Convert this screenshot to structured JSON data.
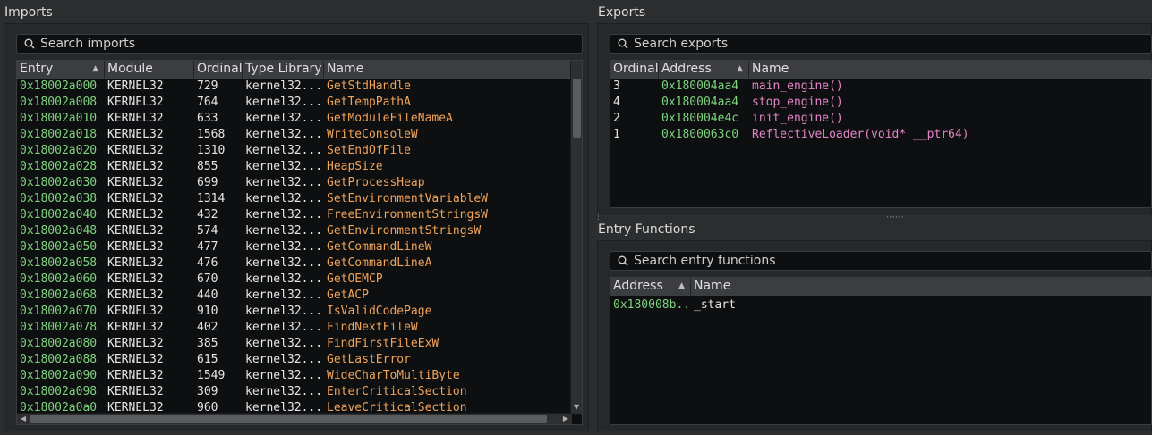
{
  "imports": {
    "title": "Imports",
    "search_placeholder": "Search imports",
    "columns": [
      "Entry",
      "Module",
      "Ordinal",
      "Type Library",
      "Name"
    ],
    "sorted_column": "Entry",
    "rows": [
      [
        "0x18002a000",
        "KERNEL32",
        "729",
        "kernel32....",
        "GetStdHandle"
      ],
      [
        "0x18002a008",
        "KERNEL32",
        "764",
        "kernel32....",
        "GetTempPathA"
      ],
      [
        "0x18002a010",
        "KERNEL32",
        "633",
        "kernel32....",
        "GetModuleFileNameA"
      ],
      [
        "0x18002a018",
        "KERNEL32",
        "1568",
        "kernel32....",
        "WriteConsoleW"
      ],
      [
        "0x18002a020",
        "KERNEL32",
        "1310",
        "kernel32....",
        "SetEndOfFile"
      ],
      [
        "0x18002a028",
        "KERNEL32",
        "855",
        "kernel32....",
        "HeapSize"
      ],
      [
        "0x18002a030",
        "KERNEL32",
        "699",
        "kernel32....",
        "GetProcessHeap"
      ],
      [
        "0x18002a038",
        "KERNEL32",
        "1314",
        "kernel32....",
        "SetEnvironmentVariableW"
      ],
      [
        "0x18002a040",
        "KERNEL32",
        "432",
        "kernel32....",
        "FreeEnvironmentStringsW"
      ],
      [
        "0x18002a048",
        "KERNEL32",
        "574",
        "kernel32....",
        "GetEnvironmentStringsW"
      ],
      [
        "0x18002a050",
        "KERNEL32",
        "477",
        "kernel32....",
        "GetCommandLineW"
      ],
      [
        "0x18002a058",
        "KERNEL32",
        "476",
        "kernel32....",
        "GetCommandLineA"
      ],
      [
        "0x18002a060",
        "KERNEL32",
        "670",
        "kernel32....",
        "GetOEMCP"
      ],
      [
        "0x18002a068",
        "KERNEL32",
        "440",
        "kernel32....",
        "GetACP"
      ],
      [
        "0x18002a070",
        "KERNEL32",
        "910",
        "kernel32....",
        "IsValidCodePage"
      ],
      [
        "0x18002a078",
        "KERNEL32",
        "402",
        "kernel32....",
        "FindNextFileW"
      ],
      [
        "0x18002a080",
        "KERNEL32",
        "385",
        "kernel32....",
        "FindFirstFileExW"
      ],
      [
        "0x18002a088",
        "KERNEL32",
        "615",
        "kernel32....",
        "GetLastError"
      ],
      [
        "0x18002a090",
        "KERNEL32",
        "1549",
        "kernel32....",
        "WideCharToMultiByte"
      ],
      [
        "0x18002a098",
        "KERNEL32",
        "309",
        "kernel32....",
        "EnterCriticalSection"
      ],
      [
        "0x18002a0a0",
        "KERNEL32",
        "960",
        "kernel32....",
        "LeaveCriticalSection"
      ]
    ]
  },
  "exports": {
    "title": "Exports",
    "search_placeholder": "Search exports",
    "columns": [
      "Ordinal",
      "Address",
      "Name"
    ],
    "sorted_column": "Address",
    "rows": [
      [
        "3",
        "0x180004aa4",
        "main_engine()"
      ],
      [
        "4",
        "0x180004aa4",
        "stop_engine()"
      ],
      [
        "2",
        "0x180004e4c",
        "init_engine()"
      ],
      [
        "1",
        "0x1800063c0",
        "ReflectiveLoader(void* __ptr64)"
      ]
    ]
  },
  "entry_functions": {
    "title": "Entry Functions",
    "search_placeholder": "Search entry functions",
    "columns": [
      "Address",
      "Name"
    ],
    "sorted_column": "Address",
    "rows": [
      [
        "0x180008b...",
        "_start"
      ]
    ]
  },
  "icons": {
    "search": "search-icon",
    "sort": "sort-ascending-icon"
  },
  "colors": {
    "background": "#2b2d2f",
    "table_bg": "#0e0f10",
    "address": "#7ed47e",
    "import_name": "#f0a35a",
    "export_name": "#e487c9"
  }
}
